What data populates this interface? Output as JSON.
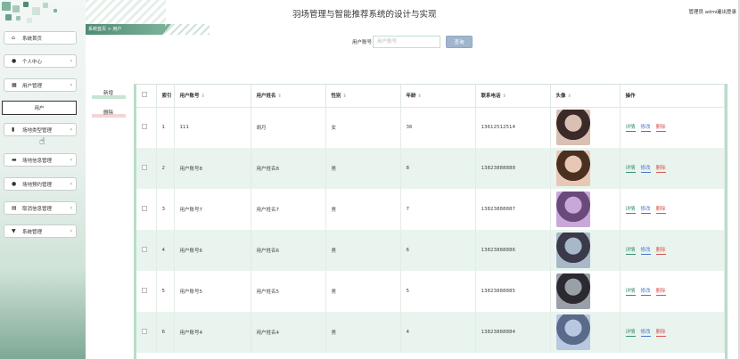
{
  "app": {
    "title": "羽场管理与智能推荐系统的设计与实现",
    "user_info": "管理员 admin",
    "logout": "退出登录"
  },
  "breadcrumb": "系统首页  >  用户",
  "sidebar": {
    "items": [
      {
        "label": "系统首页",
        "icon": "home-icon"
      },
      {
        "label": "个人中心",
        "icon": "user-icon"
      },
      {
        "label": "用户管理",
        "icon": "grid-icon"
      },
      {
        "label": "场地类型管理",
        "icon": "chart-icon"
      },
      {
        "label": "场地信息管理",
        "icon": "briefcase-icon"
      },
      {
        "label": "场地预约管理",
        "icon": "user-icon"
      },
      {
        "label": "取消信息管理",
        "icon": "table-icon"
      },
      {
        "label": "系统管理",
        "icon": "trophy-icon"
      }
    ],
    "sub_item": "用户"
  },
  "search": {
    "label": "用户账号",
    "placeholder": "用户账号",
    "button": "查询"
  },
  "actions": {
    "add": "新增",
    "delete": "删除"
  },
  "table": {
    "headers": [
      "",
      "索引",
      "用户账号",
      "用户姓名",
      "性别",
      "年龄",
      "联系电话",
      "头像",
      "操作"
    ],
    "rows": [
      {
        "index": "1",
        "account": "111",
        "name": "胡月",
        "gender": "女",
        "age": "36",
        "phone": "13612512514"
      },
      {
        "index": "2",
        "account": "用户账号8",
        "name": "用户姓名8",
        "gender": "男",
        "age": "8",
        "phone": "13823888888"
      },
      {
        "index": "3",
        "account": "用户账号7",
        "name": "用户姓名7",
        "gender": "男",
        "age": "7",
        "phone": "13823888887"
      },
      {
        "index": "4",
        "account": "用户账号6",
        "name": "用户姓名6",
        "gender": "男",
        "age": "6",
        "phone": "13823888886"
      },
      {
        "index": "5",
        "account": "用户账号5",
        "name": "用户姓名5",
        "gender": "男",
        "age": "5",
        "phone": "13823888885"
      },
      {
        "index": "6",
        "account": "用户账号4",
        "name": "用户姓名4",
        "gender": "男",
        "age": "4",
        "phone": "13823888884"
      }
    ],
    "ops": {
      "detail": "详情",
      "edit": "修改",
      "delete": "删除"
    }
  },
  "colors": {
    "accent": "#4f8c74",
    "row_alt": "#e9f4ee",
    "detail": "#3a8f6e",
    "edit": "#4a76c9",
    "delete": "#d9534f"
  }
}
